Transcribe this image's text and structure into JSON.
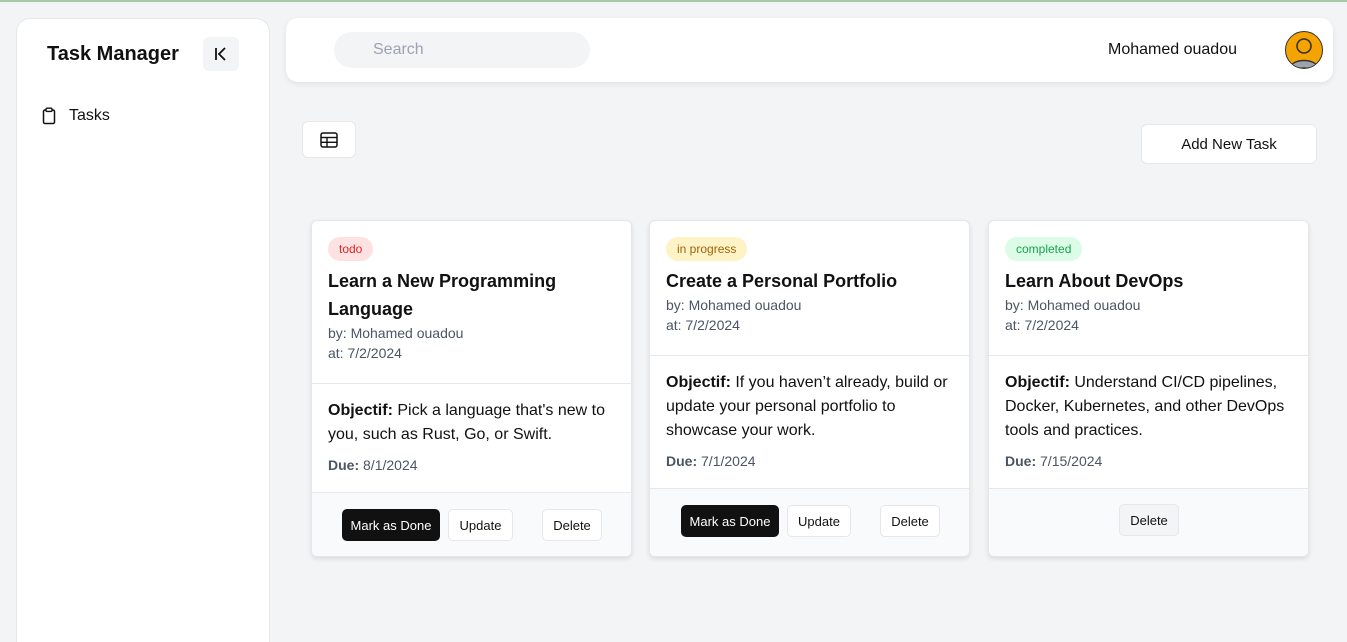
{
  "sidebar": {
    "brand": "Task Manager",
    "items": [
      {
        "label": "Tasks",
        "icon": "clipboard-icon"
      }
    ]
  },
  "header": {
    "search_placeholder": "Search",
    "search_value": "",
    "username": "Mohamed ouadou"
  },
  "toolbar": {
    "add_label": "Add New Task",
    "view_icon": "table-icon"
  },
  "labels": {
    "objectif": "Objectif:",
    "due": "Due:",
    "mark_done": "Mark as Done",
    "update": "Update",
    "delete": "Delete"
  },
  "tasks": [
    {
      "status": "todo",
      "title": "Learn a New Programming Language",
      "by": "by: Mohamed ouadou",
      "at": "at: 7/2/2024",
      "objective": "Pick a language that's new to you, such as Rust, Go, or Swift.",
      "due": "8/1/2024"
    },
    {
      "status": "in progress",
      "title": "Create a Personal Portfolio",
      "by": "by: Mohamed ouadou",
      "at": "at: 7/2/2024",
      "objective": "If you haven’t already, build or update your personal portfolio to showcase your work.",
      "due": "7/1/2024"
    },
    {
      "status": "completed",
      "title": "Learn About DevOps",
      "by": "by: Mohamed ouadou",
      "at": "at: 7/2/2024",
      "objective": "Understand CI/CD pipelines, Docker, Kubernetes, and other DevOps tools and practices.",
      "due": "7/15/2024"
    }
  ],
  "colors": {
    "todo": "#dc2626",
    "in_progress": "#a16207",
    "completed": "#16a34a",
    "avatar": "#f5a300"
  }
}
